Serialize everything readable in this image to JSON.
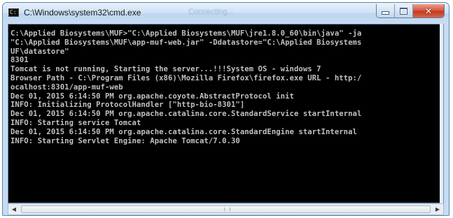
{
  "window": {
    "title": "C:\\Windows\\system32\\cmd.exe",
    "background_title": "Connecting..."
  },
  "console": {
    "lines": [
      "C:\\Applied Biosystems\\MUF>\"C:\\Applied Biosystems\\MUF\\jre1.8.0_60\\bin\\java\" -ja",
      "\"C:\\Applied Biosystems\\MUF\\app-muf-web.jar\" -Ddatastore=\"C:\\Applied Biosystems",
      "UF\\datastore\"",
      "8301",
      "Tomcat is not running, Starting the server...!!!System OS - windows 7",
      "Browser Path - C:\\Program Files (x86)\\Mozilla Firefox\\firefox.exe URL - http:/",
      "ocalhost:8301/app-muf-web",
      "Dec 01, 2015 6:14:50 PM org.apache.coyote.AbstractProtocol init",
      "INFO: Initializing ProtocolHandler [\"http-bio-8301\"]",
      "Dec 01, 2015 6:14:50 PM org.apache.catalina.core.StandardService startInternal",
      "INFO: Starting service Tomcat",
      "Dec 01, 2015 6:14:50 PM org.apache.catalina.core.StandardEngine startInternal",
      "INFO: Starting Servlet Engine: Apache Tomcat/7.0.30"
    ]
  },
  "icons": {
    "app_icon": "console-icon",
    "minimize": "minimize-icon",
    "maximize": "maximize-icon",
    "close": "close-icon",
    "scroll_left": "arrow-left-icon",
    "scroll_right": "arrow-right-icon"
  },
  "colors": {
    "console_background": "#000000",
    "console_text": "#c0c0c0",
    "close_button": "#c9462b",
    "frame": "#c6dcf2"
  }
}
